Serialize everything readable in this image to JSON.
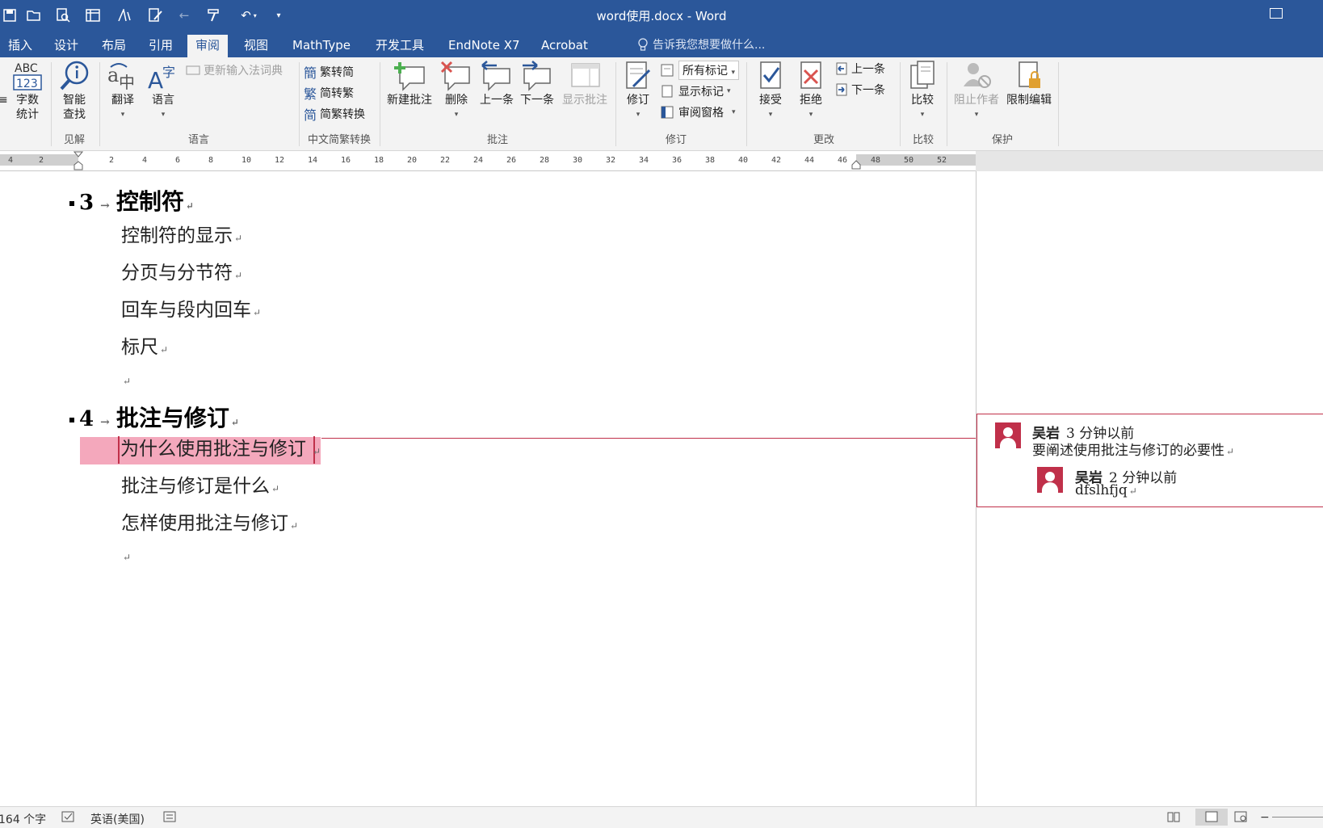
{
  "window": {
    "title": "word使用.docx - Word"
  },
  "tabs": [
    {
      "label": "插入"
    },
    {
      "label": "设计"
    },
    {
      "label": "布局"
    },
    {
      "label": "引用"
    },
    {
      "label": "审阅"
    },
    {
      "label": "视图"
    },
    {
      "label": "MathType"
    },
    {
      "label": "开发工具"
    },
    {
      "label": "EndNote X7"
    },
    {
      "label": "Acrobat"
    }
  ],
  "active_tab": "审阅",
  "tell_me": "告诉我您想要做什么...",
  "ribbon": {
    "groups": {
      "insights": "见解",
      "language": "语言",
      "chinese_conversion": "中文简繁转换",
      "comments": "批注",
      "tracking": "修订",
      "changes": "更改",
      "compare": "比较",
      "protect": "保护"
    },
    "word_count": [
      "字数",
      "统计"
    ],
    "smart_lookup": [
      "智能",
      "查找"
    ],
    "translate": "翻译",
    "language": "语言",
    "update_ime": "更新输入法词典",
    "trad_to_simp": "繁转简",
    "simp_to_trad": "简转繁",
    "simp_trad_convert": "简繁转换",
    "new_comment": "新建批注",
    "delete": "删除",
    "previous": "上一条",
    "next": "下一条",
    "show_comments": "显示批注",
    "track_changes": "修订",
    "all_markup": "所有标记",
    "show_markup": "显示标记",
    "reviewing_pane": "审阅窗格",
    "accept": "接受",
    "reject": "拒绝",
    "prev_change": "上一条",
    "next_change": "下一条",
    "compare": "比较",
    "block_authors": "阻止作者",
    "restrict_editing": "限制编辑"
  },
  "ruler": {
    "ticks": [
      "4",
      "2",
      "2",
      "4",
      "6",
      "8",
      "10",
      "12",
      "14",
      "16",
      "18",
      "20",
      "22",
      "24",
      "26",
      "28",
      "30",
      "32",
      "34",
      "36",
      "38",
      "40",
      "42",
      "44",
      "46",
      "48",
      "50",
      "52"
    ]
  },
  "document": {
    "heading3": {
      "number": "3",
      "text": "控制符"
    },
    "h3_items": [
      "控制符的显示",
      "分页与分节符",
      "回车与段内回车",
      "标尺"
    ],
    "heading4": {
      "number": "4",
      "text": "批注与修订"
    },
    "h4_items": [
      "为什么使用批注与修订",
      "批注与修订是什么",
      "怎样使用批注与修订"
    ]
  },
  "comments": [
    {
      "author": "吴岩",
      "time": "3 分钟以前",
      "text": "要阐述使用批注与修订的必要性"
    },
    {
      "author": "吴岩",
      "time": "2 分钟以前",
      "text": "dfslhfjq"
    }
  ],
  "status": {
    "words": "164 个字",
    "language": "英语(美国)"
  }
}
